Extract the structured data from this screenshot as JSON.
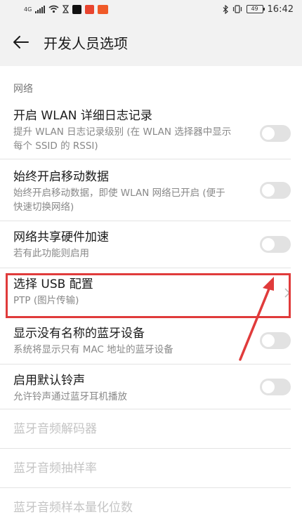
{
  "status_bar": {
    "network_label": "4G",
    "time": "16:42",
    "battery": "49"
  },
  "header": {
    "title": "开发人员选项"
  },
  "section": {
    "title": "网络"
  },
  "settings": [
    {
      "title": "开启 WLAN 详细日志记录",
      "subtitle": "提升 WLAN 日志记录级别 (在 WLAN 选择器中显示每个 SSID 的 RSSI)",
      "control": "toggle",
      "enabled": false
    },
    {
      "title": "始终开启移动数据",
      "subtitle": "始终开启移动数据，即使 WLAN 网络已开启 (便于快速切换网络)",
      "control": "toggle",
      "enabled": false
    },
    {
      "title": "网络共享硬件加速",
      "subtitle": "若有此功能则启用",
      "control": "toggle",
      "enabled": false
    },
    {
      "title": "选择 USB 配置",
      "subtitle": "PTP (图片传输)",
      "control": "chevron"
    },
    {
      "title": "显示没有名称的蓝牙设备",
      "subtitle": "系统将显示只有 MAC 地址的蓝牙设备",
      "control": "toggle",
      "enabled": false
    },
    {
      "title": "启用默认铃声",
      "subtitle": "允许铃声通过蓝牙耳机播放",
      "control": "toggle",
      "enabled": false
    },
    {
      "title": "蓝牙音频解码器",
      "control": "none",
      "disabled": true
    },
    {
      "title": "蓝牙音频抽样率",
      "control": "none",
      "disabled": true
    },
    {
      "title": "蓝牙音频样本量化位数",
      "control": "none",
      "disabled": true
    }
  ],
  "colors": {
    "highlight": "#e03b3b",
    "header_bg": "#f2f2f2",
    "toggle_off": "#e2e2e2"
  }
}
